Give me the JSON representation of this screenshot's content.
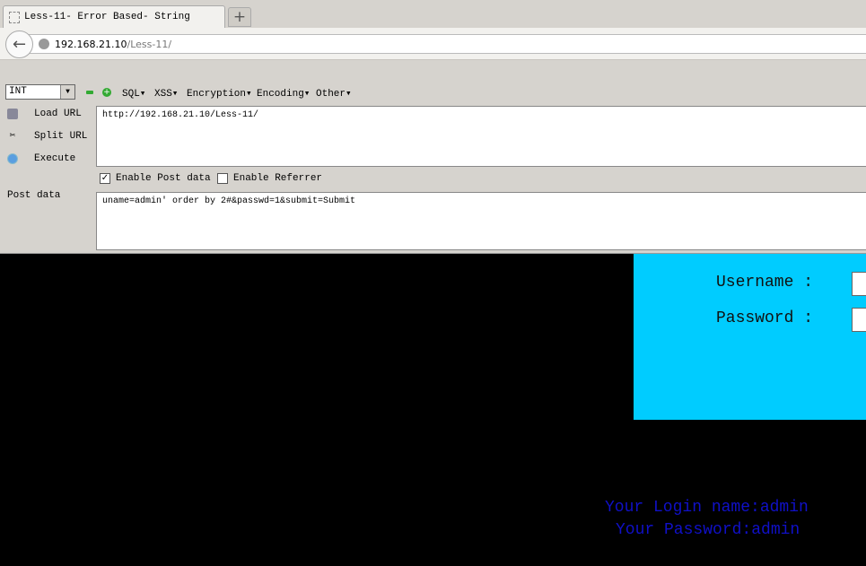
{
  "tab": {
    "title": "Less-11- Error Based- String",
    "new_tab": "+"
  },
  "address": {
    "host": "192.168.21.10",
    "path": "/Less-11/"
  },
  "hackbar": {
    "select_value": "INT",
    "menus": [
      "SQL▾",
      "XSS▾",
      "Encryption▾",
      "Encoding▾",
      "Other▾"
    ],
    "load_url": "Load URL",
    "split_url": "Split URL",
    "execute": "Execute",
    "url_value": "http://192.168.21.10/Less-11/",
    "enable_post": "Enable Post data",
    "enable_post_checked": true,
    "enable_referrer": "Enable Referrer",
    "enable_referrer_checked": false,
    "post_label": "Post data",
    "post_value": "uname=admin' order by 2#&passwd=1&submit=Submit"
  },
  "page": {
    "username_label": "Username :",
    "password_label": "Password :",
    "login_name": "Your Login name:admin",
    "password_result": "Your Password:admin",
    "panel_color": "#00ccff",
    "result_color": "#1010c8"
  }
}
